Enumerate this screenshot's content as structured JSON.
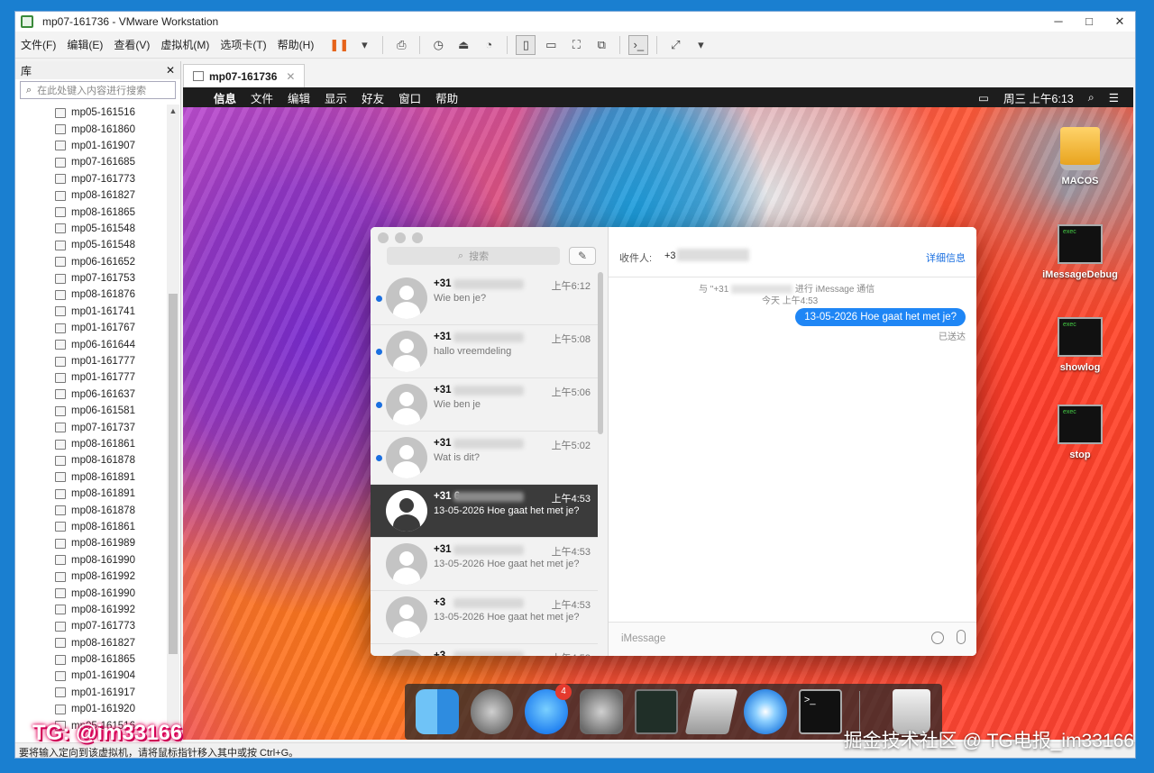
{
  "window": {
    "title": "mp07-161736 - VMware Workstation",
    "ctrl_min": "─",
    "ctrl_max": "□",
    "ctrl_close": "✕"
  },
  "menu": [
    "文件(F)",
    "编辑(E)",
    "查看(V)",
    "虚拟机(M)",
    "选项卡(T)",
    "帮助(H)"
  ],
  "library": {
    "title": "库",
    "close": "✕",
    "search_placeholder": "在此处键入内容进行搜索",
    "items": [
      "mp05-161516",
      "mp08-161860",
      "mp01-161907",
      "mp07-161685",
      "mp07-161773",
      "mp08-161827",
      "mp08-161865",
      "mp05-161548",
      "mp05-161548",
      "mp06-161652",
      "mp07-161753",
      "mp08-161876",
      "mp01-161741",
      "mp01-161767",
      "mp06-161644",
      "mp01-161777",
      "mp01-161777",
      "mp06-161637",
      "mp06-161581",
      "mp07-161737",
      "mp08-161861",
      "mp08-161878",
      "mp08-161891",
      "mp08-161891",
      "mp08-161878",
      "mp08-161861",
      "mp08-161989",
      "mp08-161990",
      "mp08-161992",
      "mp08-161990",
      "mp08-161992",
      "mp07-161773",
      "mp08-161827",
      "mp08-161865",
      "mp01-161904",
      "mp01-161917",
      "mp01-161920",
      "mp05-161516"
    ]
  },
  "tab": {
    "label": "mp07-161736",
    "close": "✕"
  },
  "mac_menu": {
    "apple": "",
    "items": [
      "信息",
      "文件",
      "编辑",
      "显示",
      "好友",
      "窗口",
      "帮助"
    ],
    "clock": "周三 上午6:13"
  },
  "desktop_icons": [
    {
      "label": "MACOS"
    },
    {
      "label": "iMessageDebug"
    },
    {
      "label": "showlog"
    },
    {
      "label": "stop"
    }
  ],
  "messages": {
    "search_placeholder": "搜索",
    "compose_icon": "✎",
    "conversations": [
      {
        "name": "+31",
        "time": "上午6:12",
        "preview": "Wie ben je?",
        "unread": true,
        "selected": false
      },
      {
        "name": "+31",
        "time": "上午5:08",
        "preview": "hallo vreemdeling",
        "unread": true,
        "selected": false
      },
      {
        "name": "+31",
        "time": "上午5:06",
        "preview": "Wie ben je",
        "unread": true,
        "selected": false
      },
      {
        "name": "+31",
        "time": "上午5:02",
        "preview": "Wat is dit?",
        "unread": true,
        "selected": false
      },
      {
        "name": "+31 6",
        "time": "上午4:53",
        "preview": "13-05-2026 Hoe gaat het met je?",
        "unread": false,
        "selected": true
      },
      {
        "name": "+31",
        "time": "上午4:53",
        "preview": "13-05-2026 Hoe gaat het met je?",
        "unread": false,
        "selected": false
      },
      {
        "name": "+3",
        "time": "上午4:53",
        "preview": "13-05-2026 Hoe gaat het met je?",
        "unread": false,
        "selected": false
      },
      {
        "name": "+3",
        "time": "上午4:53",
        "preview": "",
        "unread": false,
        "selected": false
      }
    ],
    "chat": {
      "to_label": "收件人:",
      "to_value": "+3",
      "details": "详细信息",
      "info_prefix": "与 \"+31",
      "info_suffix": "进行 iMessage 通信",
      "info_time": "今天 上午4:53",
      "bubble": "13-05-2026 Hoe gaat het met je?",
      "delivered": "已送达",
      "input_placeholder": "iMessage"
    }
  },
  "dock": {
    "messages_badge": "4",
    "terminal_prompt": ">_"
  },
  "statusbar": "要将输入定向到该虚拟机，请将鼠标指针移入其中或按 Ctrl+G。",
  "watermark_left": "TG: @im33166",
  "watermark_right": "掘金技术社区 @ TG电报_im33166"
}
